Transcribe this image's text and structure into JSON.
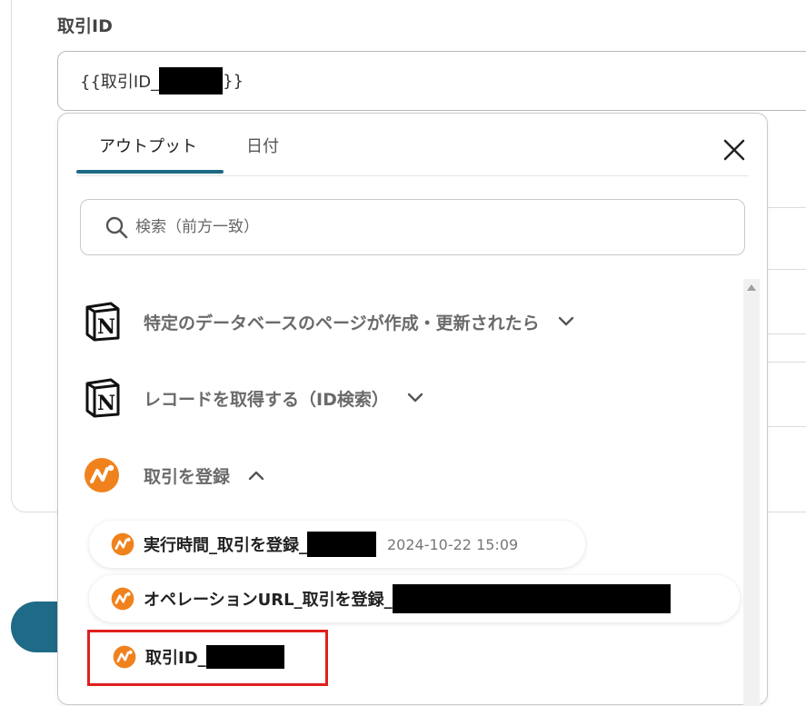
{
  "field": {
    "label": "取引ID",
    "value_prefix": "{{取引ID_",
    "value_suffix": "}}"
  },
  "tabs": [
    {
      "label": "アウトプット",
      "active": true
    },
    {
      "label": "日付",
      "active": false
    }
  ],
  "search": {
    "placeholder": "検索（前方一致）"
  },
  "sections": [
    {
      "label": "特定のデータベースのページが作成・更新されたら",
      "icon": "notion-icon",
      "expanded": false
    },
    {
      "label": "レコードを取得する（ID検索）",
      "icon": "notion-icon",
      "expanded": false
    },
    {
      "label": "取引を登録",
      "icon": "app-logo-icon",
      "expanded": true
    }
  ],
  "items": [
    {
      "label": "実行時間_取引を登録_",
      "timestamp": "2024-10-22 15:09"
    },
    {
      "label": "オペレーションURL_取引を登録_"
    },
    {
      "label": "取引ID_"
    }
  ],
  "colors": {
    "accent": "#1f6a86",
    "brand_orange": "#f0821e",
    "highlight": "#e0201e"
  }
}
